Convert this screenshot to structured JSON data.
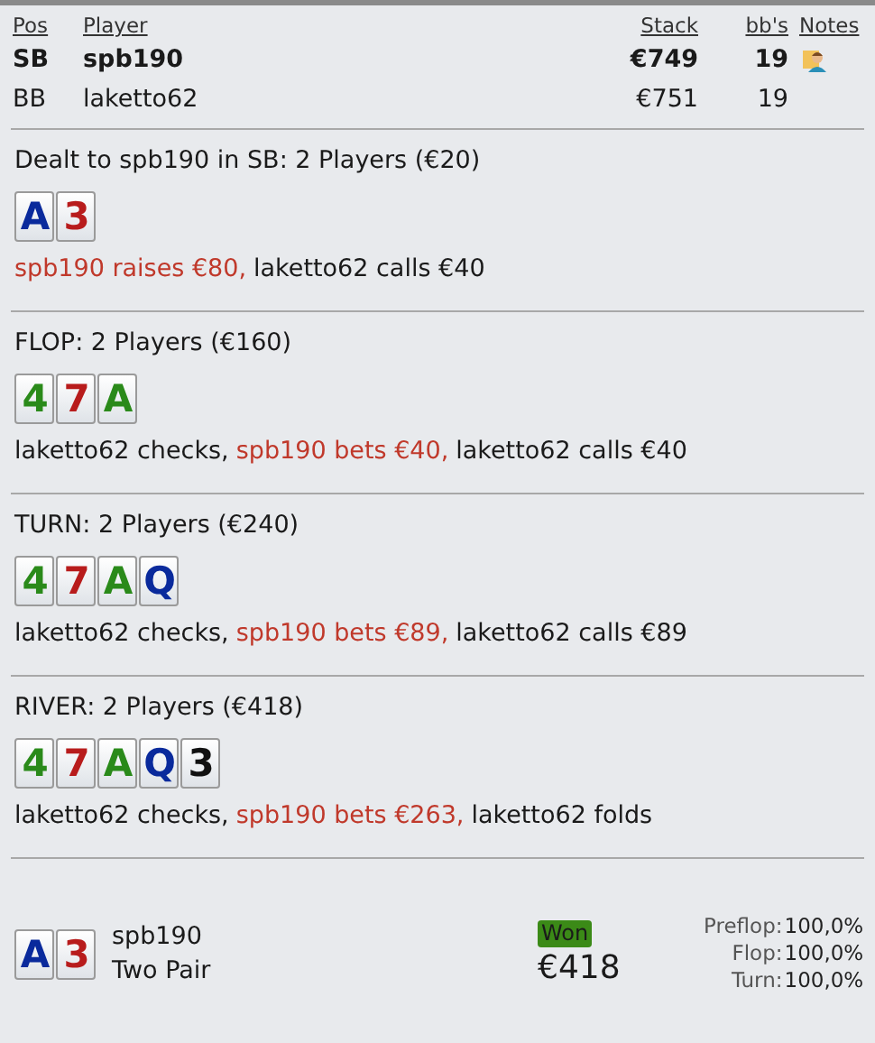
{
  "players": {
    "columns": [
      {
        "label": "Pos"
      },
      {
        "label": "Player"
      },
      {
        "label": "Stack"
      },
      {
        "label": "bb's"
      },
      {
        "label": "Notes"
      }
    ],
    "rows": [
      {
        "pos": "SB",
        "player": "spb190",
        "stack": "€749",
        "bbs": "19",
        "hero": true,
        "has_note": true
      },
      {
        "pos": "BB",
        "player": "laketto62",
        "stack": "€751",
        "bbs": "19",
        "hero": false
      }
    ]
  },
  "streets": [
    {
      "title": "Dealt to spb190 in SB: 2 Players (€20)",
      "cards": [
        {
          "rank": "A",
          "color": "#0a2a9c"
        },
        {
          "rank": "3",
          "color": "#b81c1c"
        }
      ],
      "actions": [
        {
          "text": "spb190 raises €80,",
          "hero": true
        },
        {
          "text": "laketto62 calls €40",
          "hero": false
        }
      ]
    },
    {
      "title": "FLOP: 2 Players (€160)",
      "cards": [
        {
          "rank": "4",
          "color": "#2a8a1a"
        },
        {
          "rank": "7",
          "color": "#b81c1c"
        },
        {
          "rank": "A",
          "color": "#2a8a1a"
        }
      ],
      "actions": [
        {
          "text": "laketto62 checks,",
          "hero": false
        },
        {
          "text": "spb190 bets €40,",
          "hero": true
        },
        {
          "text": "laketto62 calls €40",
          "hero": false
        }
      ]
    },
    {
      "title": "TURN: 2 Players (€240)",
      "cards": [
        {
          "rank": "4",
          "color": "#2a8a1a"
        },
        {
          "rank": "7",
          "color": "#b81c1c"
        },
        {
          "rank": "A",
          "color": "#2a8a1a"
        },
        {
          "rank": "Q",
          "color": "#0a2a9c"
        }
      ],
      "actions": [
        {
          "text": "laketto62 checks,",
          "hero": false
        },
        {
          "text": "spb190 bets €89,",
          "hero": true
        },
        {
          "text": "laketto62 calls €89",
          "hero": false
        }
      ]
    },
    {
      "title": "RIVER: 2 Players (€418)",
      "cards": [
        {
          "rank": "4",
          "color": "#2a8a1a"
        },
        {
          "rank": "7",
          "color": "#b81c1c"
        },
        {
          "rank": "A",
          "color": "#2a8a1a"
        },
        {
          "rank": "Q",
          "color": "#0a2a9c"
        },
        {
          "rank": "3",
          "color": "#111111"
        }
      ],
      "actions": [
        {
          "text": "laketto62 checks,",
          "hero": false
        },
        {
          "text": "spb190 bets €263,",
          "hero": true
        },
        {
          "text": "laketto62 folds",
          "hero": false
        }
      ]
    }
  ],
  "result": {
    "cards": [
      {
        "rank": "A",
        "color": "#0a2a9c"
      },
      {
        "rank": "3",
        "color": "#b81c1c"
      }
    ],
    "player": "spb190",
    "hand": "Two Pair",
    "badge": "Won",
    "amount": "€418",
    "equity": [
      {
        "label": "Preflop:",
        "value": "100,0%"
      },
      {
        "label": "Flop:",
        "value": "100,0%"
      },
      {
        "label": "Turn:",
        "value": "100,0%"
      }
    ]
  }
}
